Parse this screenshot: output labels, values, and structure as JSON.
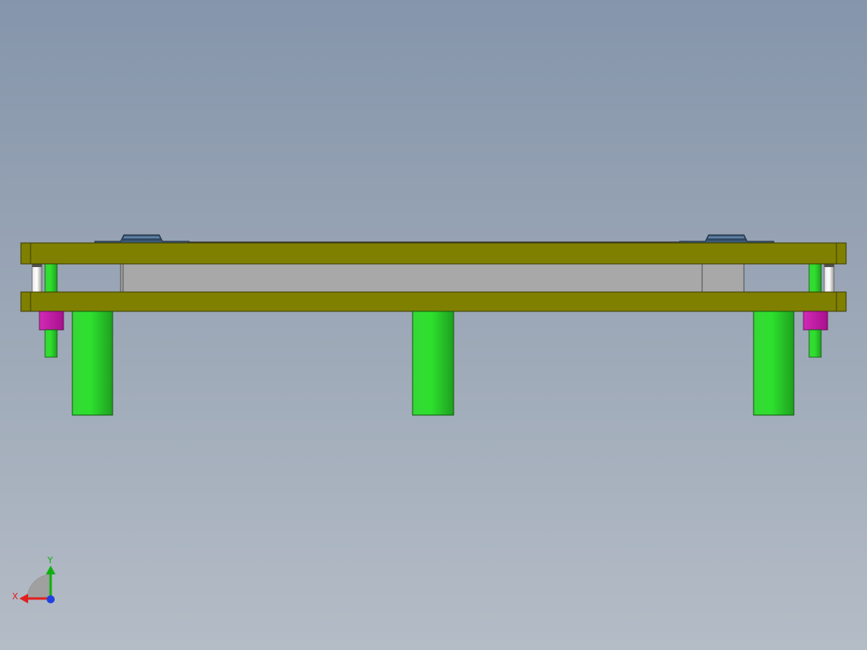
{
  "view": {
    "background_top": "#8595ab",
    "background_bottom": "#b4bcc6"
  },
  "model": {
    "plate_color": "#808000",
    "plate_edge_color": "#4a4a00",
    "spacer_block_color": "#a8a8a8",
    "post_color": "#22cc22",
    "guide_bushing_color": "#cc1aa8",
    "guide_pin_color": "#c8c8c8",
    "clamp_color": "#3c5a78"
  },
  "triad": {
    "x_label": "X",
    "y_label": "Y",
    "x_color": "#e02020",
    "y_color": "#10b010",
    "z_color": "#2040e0"
  }
}
